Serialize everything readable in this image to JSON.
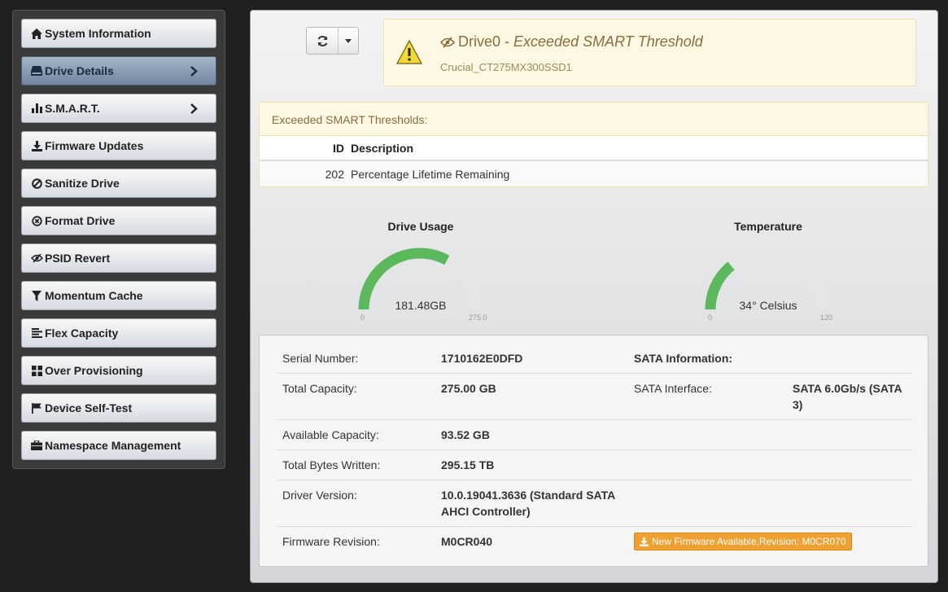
{
  "sidebar": {
    "items": [
      {
        "label": "System Information",
        "icon": "home-icon",
        "active": false,
        "chevron": false
      },
      {
        "label": "Drive Details",
        "icon": "drive-icon",
        "active": true,
        "chevron": true
      },
      {
        "label": "S.M.A.R.T.",
        "icon": "bar-chart-icon",
        "active": false,
        "chevron": true
      },
      {
        "label": "Firmware Updates",
        "icon": "download-icon",
        "active": false,
        "chevron": false
      },
      {
        "label": "Sanitize Drive",
        "icon": "ban-icon",
        "active": false,
        "chevron": false
      },
      {
        "label": "Format Drive",
        "icon": "circle-x-icon",
        "active": false,
        "chevron": false
      },
      {
        "label": "PSID Revert",
        "icon": "eye-slash-icon",
        "active": false,
        "chevron": false
      },
      {
        "label": "Momentum Cache",
        "icon": "filter-icon",
        "active": false,
        "chevron": false
      },
      {
        "label": "Flex Capacity",
        "icon": "align-left-icon",
        "active": false,
        "chevron": false
      },
      {
        "label": "Over Provisioning",
        "icon": "grid-icon",
        "active": false,
        "chevron": false
      },
      {
        "label": "Device Self-Test",
        "icon": "flag-icon",
        "active": false,
        "chevron": false
      },
      {
        "label": "Namespace Management",
        "icon": "briefcase-icon",
        "active": false,
        "chevron": false
      }
    ]
  },
  "alert": {
    "drive": "Drive0",
    "separator": " - ",
    "message": "Exceeded SMART Threshold",
    "model": "Crucial_CT275MX300SSD1",
    "color": "#8a6d3b"
  },
  "smart_table": {
    "heading": "Exceeded SMART Thresholds:",
    "col_id": "ID",
    "col_desc": "Description",
    "rows": [
      {
        "id": "202",
        "description": "Percentage Lifetime Remaining"
      }
    ]
  },
  "gauges": {
    "usage": {
      "title": "Drive Usage",
      "value_text": "181.48GB",
      "min": "0",
      "max": "275.0",
      "value": 181.48,
      "max_value": 275.0,
      "color": "#5cb85c"
    },
    "temperature": {
      "title": "Temperature",
      "value_text": "34° Celsius",
      "min": "0",
      "max": "120",
      "value": 34,
      "max_value": 120,
      "color": "#5cb85c"
    }
  },
  "details": {
    "serial_label": "Serial Number:",
    "serial_value": "1710162E0DFD",
    "sata_info_label": "SATA Information:",
    "total_cap_label": "Total Capacity:",
    "total_cap_value": "275.00 GB",
    "sata_iface_label": "SATA Interface:",
    "sata_iface_value": "SATA 6.0Gb/s (SATA 3)",
    "avail_cap_label": "Available Capacity:",
    "avail_cap_value": "93.52 GB",
    "tbw_label": "Total Bytes Written:",
    "tbw_value": "295.15 TB",
    "driver_label": "Driver Version:",
    "driver_value": "10.0.19041.3636 (Standard SATA AHCI Controller)",
    "fw_label": "Firmware Revision:",
    "fw_value": "M0CR040",
    "fw_update_button": "New Firmware Available,Revision: M0CR070"
  }
}
